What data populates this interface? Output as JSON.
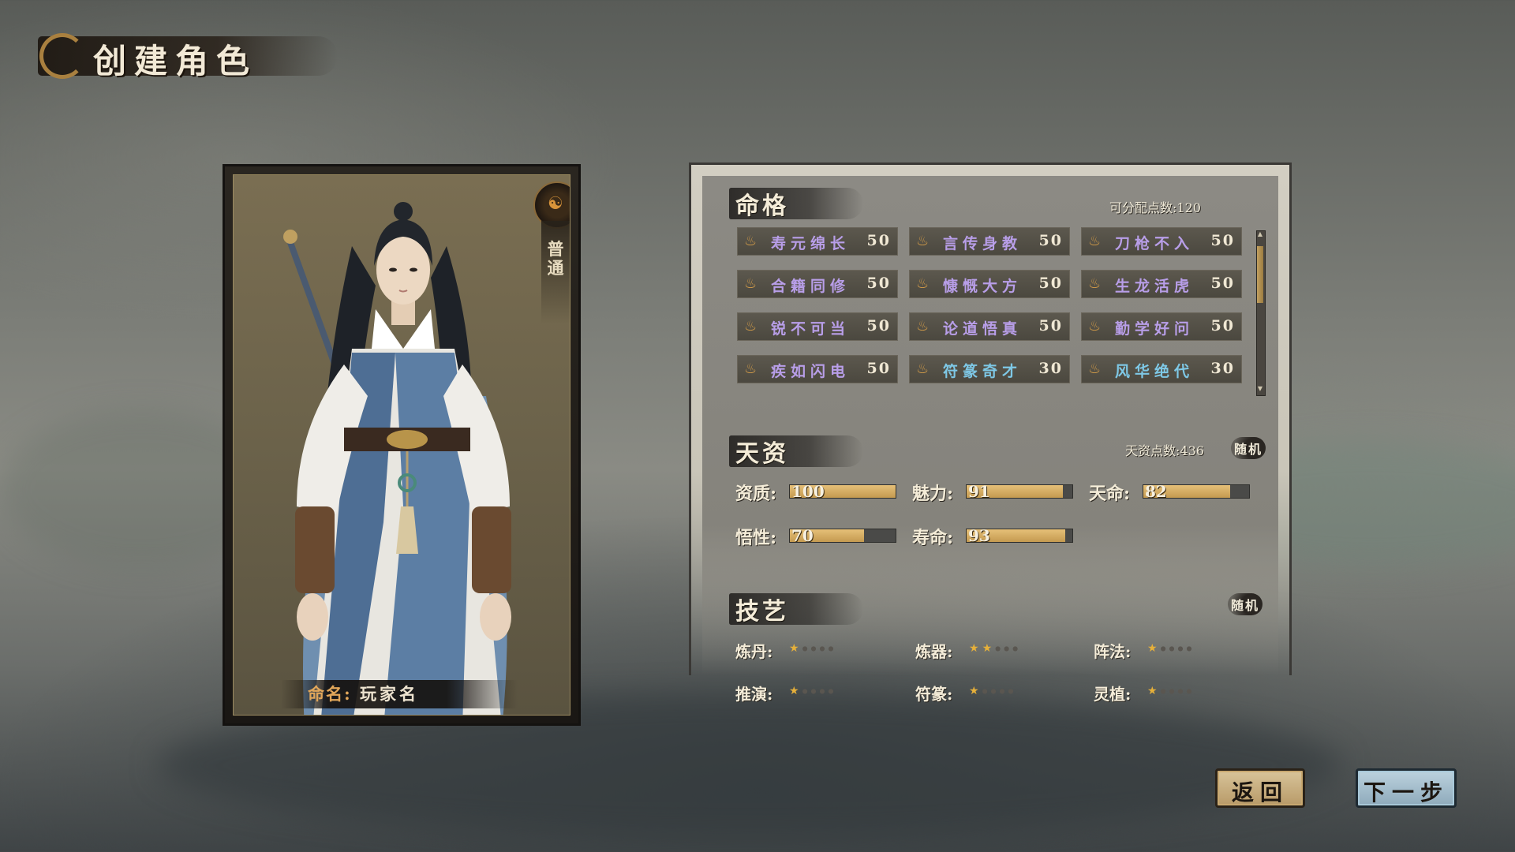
{
  "title": "创建角色",
  "character": {
    "rarity": "普通",
    "name_label": "命名:",
    "name_value": "玩家名"
  },
  "fate_section": {
    "title": "命格",
    "points_text": "可分配点数:120",
    "traits": [
      {
        "label": "寿元绵长",
        "value": "50",
        "color": "purple"
      },
      {
        "label": "言传身教",
        "value": "50",
        "color": "purple"
      },
      {
        "label": "刀枪不入",
        "value": "50",
        "color": "purple"
      },
      {
        "label": "合籍同修",
        "value": "50",
        "color": "purple"
      },
      {
        "label": "慷慨大方",
        "value": "50",
        "color": "purple"
      },
      {
        "label": "生龙活虎",
        "value": "50",
        "color": "purple"
      },
      {
        "label": "锐不可当",
        "value": "50",
        "color": "purple"
      },
      {
        "label": "论道悟真",
        "value": "50",
        "color": "purple"
      },
      {
        "label": "勤学好问",
        "value": "50",
        "color": "purple"
      },
      {
        "label": "疾如闪电",
        "value": "50",
        "color": "purple"
      },
      {
        "label": "符篆奇才",
        "value": "30",
        "color": "blue"
      },
      {
        "label": "风华绝代",
        "value": "30",
        "color": "blue"
      }
    ]
  },
  "talent_section": {
    "title": "天资",
    "points_text": "天资点数:436",
    "random_label": "随机",
    "stats": [
      {
        "label": "资质:",
        "value": 100,
        "fill": 1.0
      },
      {
        "label": "魅力:",
        "value": 91,
        "fill": 0.91
      },
      {
        "label": "天命:",
        "value": 82,
        "fill": 0.82
      },
      {
        "label": "悟性:",
        "value": 70,
        "fill": 0.7
      },
      {
        "label": "寿命:",
        "value": 93,
        "fill": 0.93
      }
    ]
  },
  "skill_section": {
    "title": "技艺",
    "random_label": "随机",
    "skills": [
      {
        "label": "炼丹:",
        "stars": 1,
        "max": 5
      },
      {
        "label": "炼器:",
        "stars": 2,
        "max": 5
      },
      {
        "label": "阵法:",
        "stars": 1,
        "max": 5
      },
      {
        "label": "推演:",
        "stars": 1,
        "max": 5
      },
      {
        "label": "符篆:",
        "stars": 1,
        "max": 5
      },
      {
        "label": "灵植:",
        "stars": 1,
        "max": 5
      }
    ]
  },
  "buttons": {
    "back": "返回",
    "next": "下一步"
  },
  "colors": {
    "accent_gold": "#e6c078",
    "trait_purple": "#b89ee8",
    "trait_blue": "#7ec8e6"
  }
}
